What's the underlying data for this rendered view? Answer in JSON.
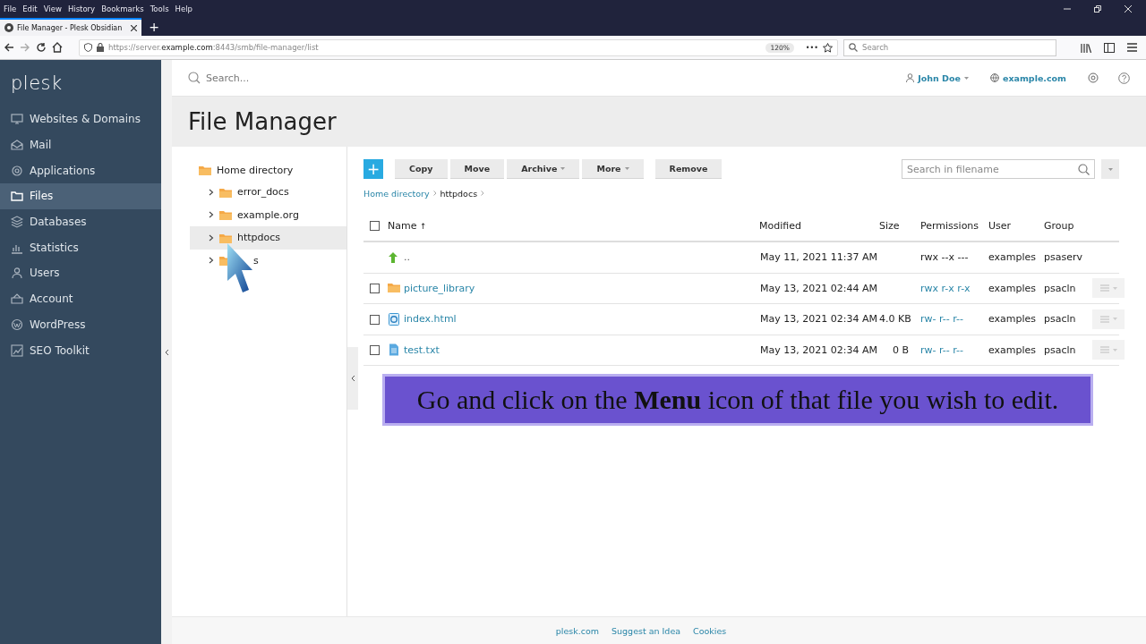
{
  "browser": {
    "menu": [
      "File",
      "Edit",
      "View",
      "History",
      "Bookmarks",
      "Tools",
      "Help"
    ],
    "tab_title": "File Manager - Plesk Obsidian",
    "new_tab": "+",
    "url": "https://server.**example.com**:8443/smb/file-manager/list",
    "zoom": "120%",
    "more": "•••",
    "search_placeholder": "Search"
  },
  "sidebar": {
    "logo": "plesk",
    "items": [
      {
        "label": "Websites & Domains",
        "selected": false
      },
      {
        "label": "Mail",
        "selected": false
      },
      {
        "label": "Applications",
        "selected": false
      },
      {
        "label": "Files",
        "selected": true
      },
      {
        "label": "Databases",
        "selected": false
      },
      {
        "label": "Statistics",
        "selected": false
      },
      {
        "label": "Users",
        "selected": false
      },
      {
        "label": "Account",
        "selected": false
      },
      {
        "label": "WordPress",
        "selected": false
      },
      {
        "label": "SEO Toolkit",
        "selected": false
      }
    ]
  },
  "topbar": {
    "search_placeholder": "Search...",
    "user": "John Doe",
    "domain": "example.com"
  },
  "page_title": "File Manager",
  "tree": {
    "root": "Home directory",
    "children": [
      {
        "label": "error_docs",
        "selected": false
      },
      {
        "label": "example.org",
        "selected": false
      },
      {
        "label": "httpdocs",
        "selected": true
      },
      {
        "label": "s",
        "selected": false
      }
    ]
  },
  "toolbar": {
    "add": "+",
    "buttons": [
      {
        "label": "Copy",
        "dropdown": false
      },
      {
        "label": "Move",
        "dropdown": false
      },
      {
        "label": "Archive",
        "dropdown": true
      },
      {
        "label": "More",
        "dropdown": true
      },
      {
        "label": "Remove",
        "dropdown": false
      }
    ],
    "search_placeholder": "Search in filename"
  },
  "breadcrumbs": [
    {
      "label": "Home directory",
      "link": true
    },
    {
      "label": "httpdocs",
      "link": false
    }
  ],
  "table": {
    "select_all_checked": false,
    "columns": [
      "Name",
      "Modified",
      "Size",
      "Permissions",
      "User",
      "Group"
    ],
    "sort_mark": "↑",
    "rows": [
      {
        "kind": "parent",
        "name": "..",
        "modified": "May 11, 2021 11:37 AM",
        "permissions": "rwx --x ---",
        "permissions_link": false,
        "user": "examples",
        "group": "psaserv"
      },
      {
        "kind": "folder",
        "checked": false,
        "name": "picture_library",
        "modified": "May 13, 2021 02:44 AM",
        "permissions": "rwx r-x r-x",
        "permissions_link": true,
        "user": "examples",
        "group": "psacln"
      },
      {
        "kind": "html",
        "checked": false,
        "name": "index.html",
        "modified": "May 13, 2021 02:34 AM",
        "size": "4.0 KB",
        "permissions": "rw- r-- r--",
        "permissions_link": true,
        "user": "examples",
        "group": "psacln"
      },
      {
        "kind": "text",
        "checked": false,
        "name": "test.txt",
        "modified": "May 13, 2021 02:34 AM",
        "size": "0 B",
        "permissions": "rw- r-- r--",
        "permissions_link": true,
        "user": "examples",
        "group": "psacln"
      }
    ]
  },
  "caption": "Go and click on the **Menu** icon of that file you wish to edit.",
  "footer": [
    "plesk.com",
    "Suggest an Idea",
    "Cookies"
  ]
}
